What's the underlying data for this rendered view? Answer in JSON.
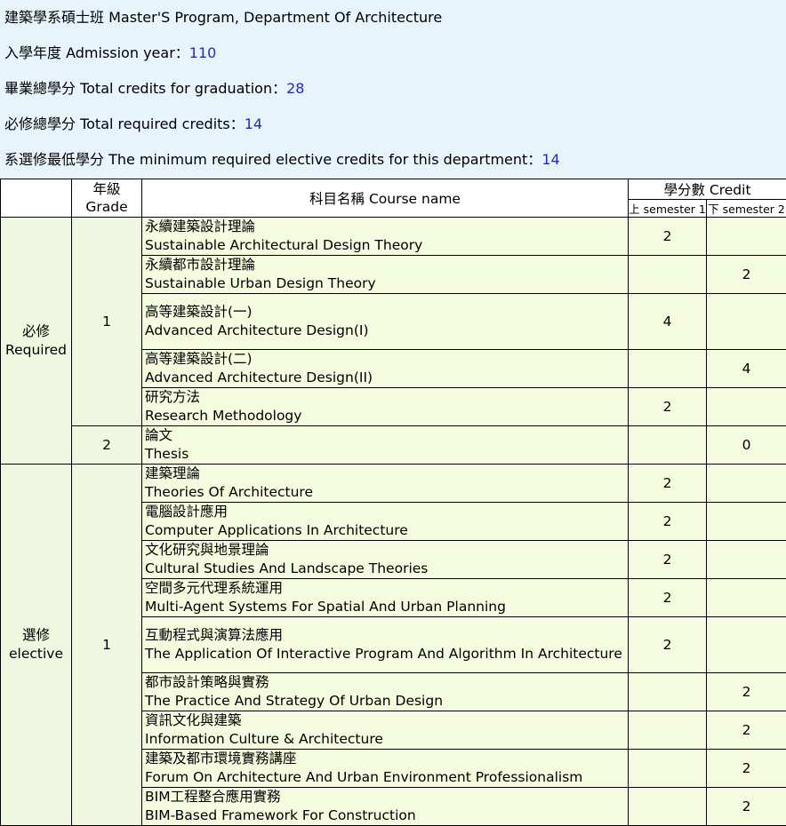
{
  "info": {
    "program": "建築學系碩士班 Master'S Program, Department Of Architecture",
    "admission_label": "入學年度 Admission year：",
    "admission_value": "110",
    "total_label": "畢業總學分 Total credits for graduation：",
    "total_value": "28",
    "required_label": "必修總學分 Total required credits：",
    "required_value": "14",
    "elective_label": "系選修最低學分 The minimum required elective credits for this department：",
    "elective_value": "14"
  },
  "table": {
    "grade_header_zh": "年級",
    "grade_header_en": "Grade",
    "course_header": "科目名稱 Course name",
    "credit_header": "學分數 Credit",
    "sem1_header": "上 semester 1",
    "sem2_header": "下 semester 2",
    "required_zh": "必修",
    "required_en": "Required",
    "elective_zh": "選修",
    "elective_en": "elective",
    "grade1": "1",
    "grade2": "2",
    "grade1_elective": "1",
    "rows": [
      {
        "zh": "永續建築設計理論",
        "en": "Sustainable Architectural Design Theory",
        "s1": "2",
        "s2": ""
      },
      {
        "zh": "永續都市設計理論",
        "en": "Sustainable Urban Design Theory",
        "s1": "",
        "s2": "2"
      },
      {
        "zh": "高等建築設計(一)",
        "en": "Advanced Architecture Design(I)",
        "s1": "4",
        "s2": ""
      },
      {
        "zh": "高等建築設計(二)",
        "en": "Advanced Architecture Design(II)",
        "s1": "",
        "s2": "4"
      },
      {
        "zh": "研究方法",
        "en": "Research Methodology",
        "s1": "2",
        "s2": ""
      },
      {
        "zh": "論文",
        "en": "Thesis",
        "s1": "",
        "s2": "0"
      },
      {
        "zh": "建築理論",
        "en": "Theories Of Architecture",
        "s1": "2",
        "s2": ""
      },
      {
        "zh": "電腦設計應用",
        "en": "Computer Applications In Architecture",
        "s1": "2",
        "s2": ""
      },
      {
        "zh": "文化研究與地景理論",
        "en": "Cultural Studies And Landscape Theories",
        "s1": "2",
        "s2": ""
      },
      {
        "zh": "空間多元代理系統運用",
        "en": "Multi-Agent Systems For Spatial And Urban Planning",
        "s1": "2",
        "s2": ""
      },
      {
        "zh": "互動程式與演算法應用",
        "en": "The Application Of Interactive Program And Algorithm In Architecture",
        "s1": "2",
        "s2": ""
      },
      {
        "zh": "都市設計策略與實務",
        "en": "The Practice And Strategy Of Urban Design",
        "s1": "",
        "s2": "2"
      },
      {
        "zh": "資訊文化與建築",
        "en": "Information Culture & Architecture",
        "s1": "",
        "s2": "2"
      },
      {
        "zh": "建築及都市環境實務講座",
        "en": "Forum On Architecture And Urban Environment Professionalism",
        "s1": "",
        "s2": "2"
      },
      {
        "zh": "BIM工程整合應用實務",
        "en": "BIM-Based Framework For Construction",
        "s1": "",
        "s2": "2"
      }
    ]
  }
}
